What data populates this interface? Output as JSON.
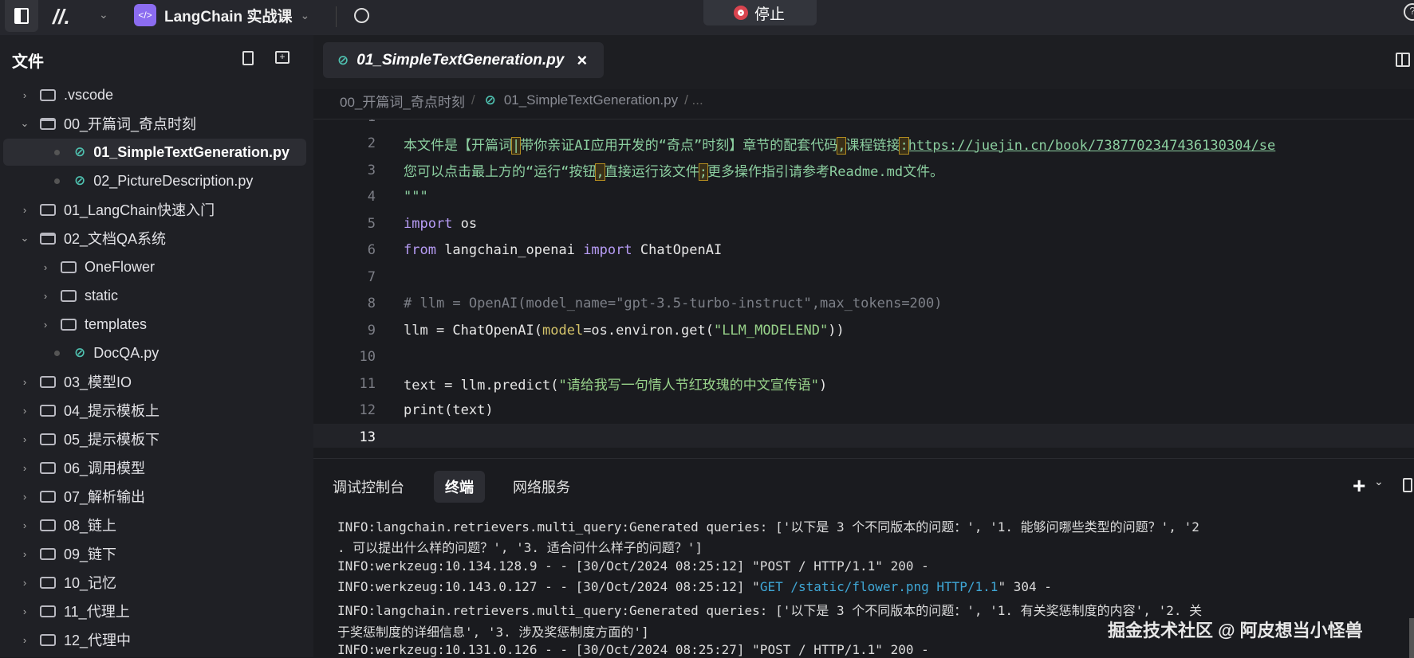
{
  "topbar": {
    "project": "LangChain 实战课",
    "stop_label": "停止"
  },
  "sidebar": {
    "title": "文件",
    "items": [
      {
        "label": ".vscode",
        "kind": "folder",
        "depth": 0,
        "open": false
      },
      {
        "label": "00_开篇词_奇点时刻",
        "kind": "folder",
        "depth": 0,
        "open": true
      },
      {
        "label": "01_SimpleTextGeneration.py",
        "kind": "py",
        "depth": 1,
        "active": true
      },
      {
        "label": "02_PictureDescription.py",
        "kind": "py",
        "depth": 1
      },
      {
        "label": "01_LangChain快速入门",
        "kind": "folder",
        "depth": 0,
        "open": false
      },
      {
        "label": "02_文档QA系统",
        "kind": "folder",
        "depth": 0,
        "open": true
      },
      {
        "label": "OneFlower",
        "kind": "folder",
        "depth": 1,
        "open": false
      },
      {
        "label": "static",
        "kind": "folder",
        "depth": 1,
        "open": false
      },
      {
        "label": "templates",
        "kind": "folder",
        "depth": 1,
        "open": false
      },
      {
        "label": "DocQA.py",
        "kind": "py",
        "depth": 1
      },
      {
        "label": "03_模型IO",
        "kind": "folder",
        "depth": 0,
        "open": false
      },
      {
        "label": "04_提示模板上",
        "kind": "folder",
        "depth": 0,
        "open": false
      },
      {
        "label": "05_提示模板下",
        "kind": "folder",
        "depth": 0,
        "open": false
      },
      {
        "label": "06_调用模型",
        "kind": "folder",
        "depth": 0,
        "open": false
      },
      {
        "label": "07_解析输出",
        "kind": "folder",
        "depth": 0,
        "open": false
      },
      {
        "label": "08_链上",
        "kind": "folder",
        "depth": 0,
        "open": false
      },
      {
        "label": "09_链下",
        "kind": "folder",
        "depth": 0,
        "open": false
      },
      {
        "label": "10_记忆",
        "kind": "folder",
        "depth": 0,
        "open": false
      },
      {
        "label": "11_代理上",
        "kind": "folder",
        "depth": 0,
        "open": false
      },
      {
        "label": "12_代理中",
        "kind": "folder",
        "depth": 0,
        "open": false
      }
    ]
  },
  "editor": {
    "tab": "01_SimpleTextGeneration.py",
    "close": "×",
    "breadcrumb": {
      "folder": "00_开篇词_奇点时刻",
      "sep": "/",
      "file": "01_SimpleTextGeneration.py",
      "more": "/ ..."
    },
    "lines": [
      {
        "n": "1",
        "tokens": []
      },
      {
        "n": "2",
        "tokens": [
          {
            "c": "doc",
            "t": "本文件是【开篇词"
          },
          {
            "c": "box",
            "t": "|"
          },
          {
            "c": "doc",
            "t": "带你亲证AI应用开发的“奇点”时刻】章节的配套代码"
          },
          {
            "c": "box",
            "t": ","
          },
          {
            "c": "doc",
            "t": "课程链接"
          },
          {
            "c": "box",
            "t": ":"
          },
          {
            "c": "link",
            "t": "https://juejin.cn/book/7387702347436130304/se"
          }
        ]
      },
      {
        "n": "3",
        "tokens": [
          {
            "c": "doc",
            "t": "您可以点击最上方的“运行“按钮"
          },
          {
            "c": "box",
            "t": ","
          },
          {
            "c": "doc",
            "t": "直接运行该文件"
          },
          {
            "c": "box",
            "t": ";"
          },
          {
            "c": "doc",
            "t": "更多操作指引请参考Readme.md文件。"
          }
        ]
      },
      {
        "n": "4",
        "tokens": [
          {
            "c": "doc",
            "t": "\"\"\""
          }
        ]
      },
      {
        "n": "5",
        "tokens": [
          {
            "c": "kw",
            "t": "import"
          },
          {
            "c": "plain",
            "t": " os"
          }
        ]
      },
      {
        "n": "6",
        "tokens": [
          {
            "c": "kw",
            "t": "from"
          },
          {
            "c": "plain",
            "t": " langchain_openai "
          },
          {
            "c": "kw",
            "t": "import"
          },
          {
            "c": "plain",
            "t": " ChatOpenAI"
          }
        ]
      },
      {
        "n": "7",
        "tokens": []
      },
      {
        "n": "8",
        "tokens": [
          {
            "c": "com",
            "t": "# llm = OpenAI(model_name=\"gpt-3.5-turbo-instruct\",max_tokens=200)"
          }
        ]
      },
      {
        "n": "9",
        "tokens": [
          {
            "c": "plain",
            "t": "llm = ChatOpenAI("
          },
          {
            "c": "param",
            "t": "model"
          },
          {
            "c": "plain",
            "t": "=os.environ.get("
          },
          {
            "c": "str",
            "t": "\"LLM_MODELEND\""
          },
          {
            "c": "plain",
            "t": "))"
          }
        ]
      },
      {
        "n": "10",
        "tokens": []
      },
      {
        "n": "11",
        "tokens": [
          {
            "c": "plain",
            "t": "text = llm.predict("
          },
          {
            "c": "str",
            "t": "\"请给我写一句情人节红玫瑰的中文宣传语\""
          },
          {
            "c": "plain",
            "t": ")"
          }
        ]
      },
      {
        "n": "12",
        "tokens": [
          {
            "c": "plain",
            "t": "print(text)"
          }
        ]
      },
      {
        "n": "13",
        "tokens": [],
        "current": true
      }
    ]
  },
  "panel": {
    "tabs": [
      "调试控制台",
      "终端",
      "网络服务"
    ],
    "active_tab": 1,
    "add": "+",
    "dropdown": "⌄",
    "terminal": [
      [
        {
          "t": "INFO:langchain.retrievers.multi_query:Generated queries: ['以下是 3 个不同版本的问题：', '1. 能够问哪些类型的问题？', '2"
        }
      ],
      [
        {
          "t": ". 可以提出什么样的问题？', '3. 适合问什么样子的问题？']"
        }
      ],
      [
        {
          "t": "INFO:werkzeug:10.134.128.9 - - [30/Oct/2024 08:25:12] \"POST / HTTP/1.1\" 200 -"
        }
      ],
      [
        {
          "t": "INFO:werkzeug:10.143.0.127 - - [30/Oct/2024 08:25:12] \""
        },
        {
          "t": "GET /static/flower.png HTTP/1.1",
          "c": "http"
        },
        {
          "t": "\" 304 -"
        }
      ],
      [
        {
          "t": "INFO:langchain.retrievers.multi_query:Generated queries: ['以下是 3 个不同版本的问题：', '1. 有关奖惩制度的内容', '2. 关"
        }
      ],
      [
        {
          "t": "于奖惩制度的详细信息', '3. 涉及奖惩制度方面的']"
        }
      ],
      [
        {
          "t": "INFO:werkzeug:10.131.0.126 - - [30/Oct/2024 08:25:27] \"POST / HTTP/1.1\" 200 -"
        }
      ]
    ]
  },
  "watermark": "掘金技术社区 @ 阿皮想当小怪兽"
}
